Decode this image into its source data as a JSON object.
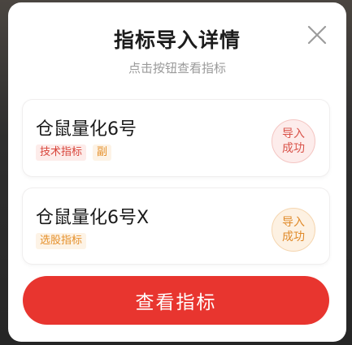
{
  "dialog": {
    "title": "指标导入详情",
    "subtitle": "点击按钮查看指标",
    "close_icon": "close-icon"
  },
  "indicators": [
    {
      "name": "仓鼠量化6号",
      "tags": [
        "技术指标",
        "副"
      ],
      "status": "导入成功",
      "status_color": "#d9534a"
    },
    {
      "name": "仓鼠量化6号X",
      "tags": [
        "选股指标"
      ],
      "status": "导入成功",
      "status_color": "#e08a2a"
    }
  ],
  "actions": {
    "view_label": "查看指标"
  },
  "colors": {
    "accent": "#e8352f",
    "tag_red": "#d8443a",
    "tag_orange": "#e5902a"
  }
}
